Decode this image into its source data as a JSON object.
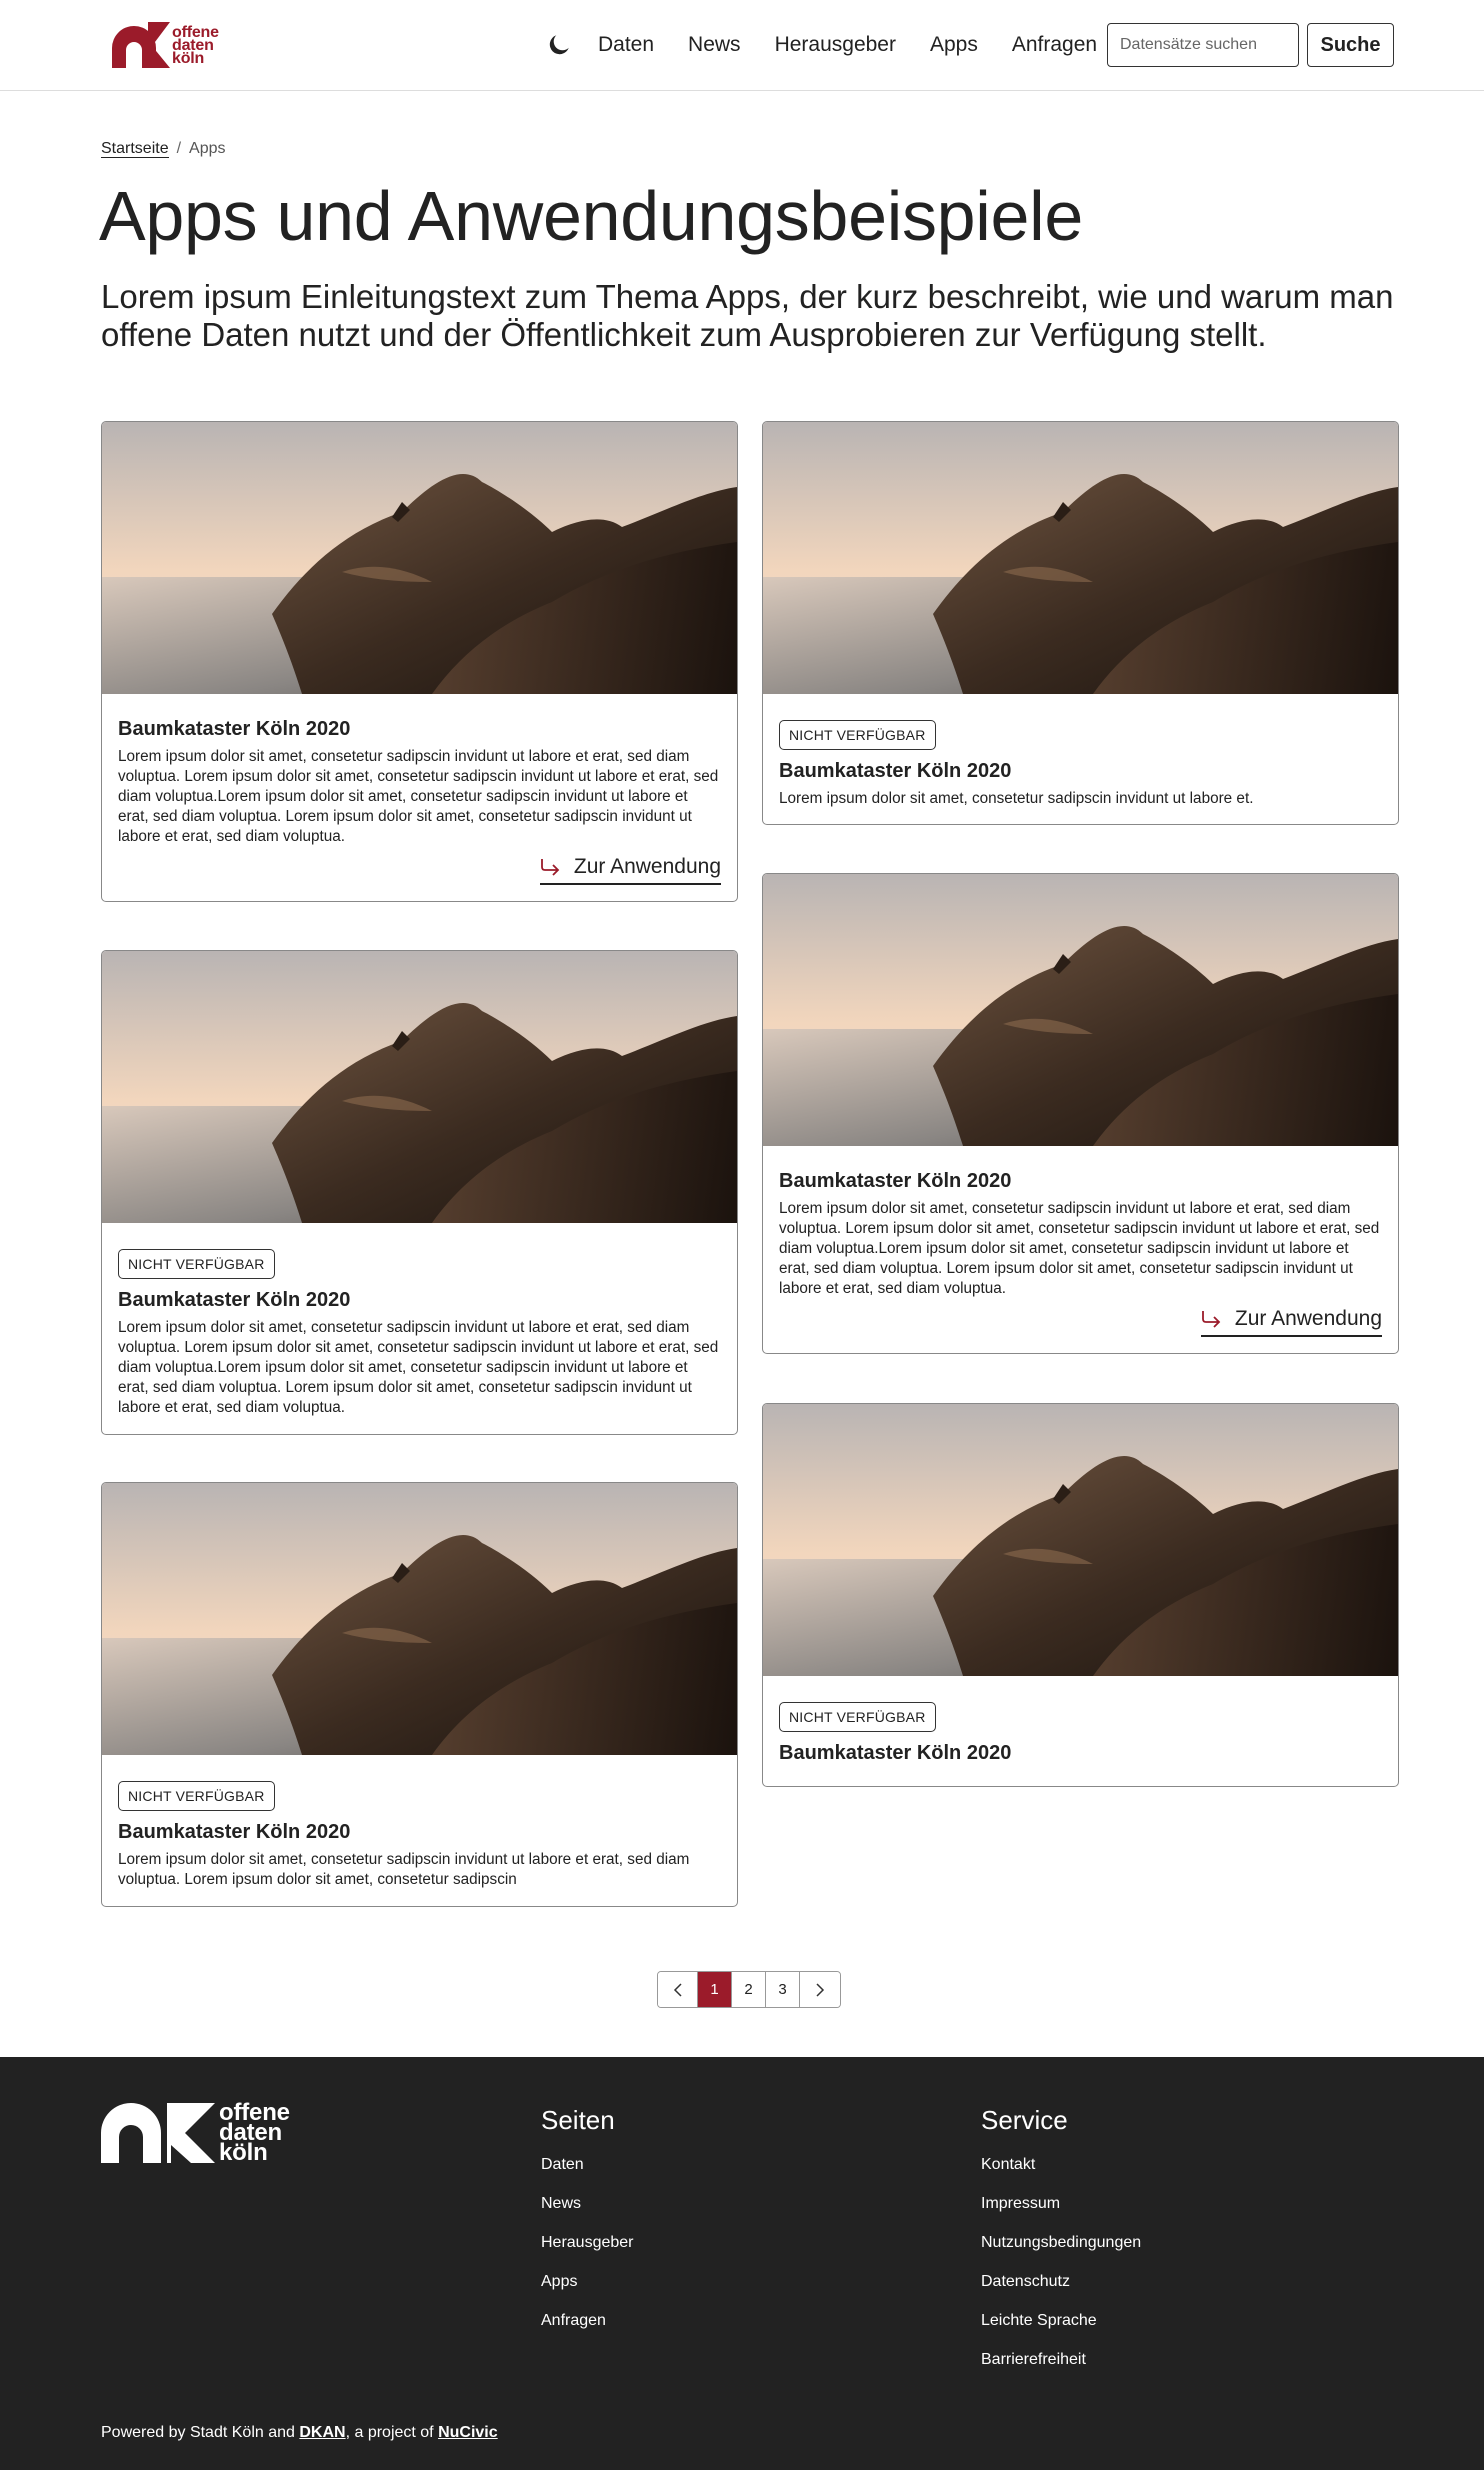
{
  "colors": {
    "brand": "#9b1b2a",
    "text": "#222222",
    "footer_bg": "#222222"
  },
  "logo": {
    "line1": "offene",
    "line2": "daten",
    "line3": "köln"
  },
  "header": {
    "theme_toggle_icon": "moon-icon",
    "nav": [
      "Daten",
      "News",
      "Herausgeber",
      "Apps",
      "Anfragen"
    ],
    "search_placeholder": "Datensätze suchen",
    "search_button": "Suche"
  },
  "breadcrumb": {
    "home": "Startseite",
    "separator": "/",
    "current": "Apps"
  },
  "page": {
    "title": "Apps und Anwendungsbeispiele",
    "intro": "Lorem ipsum Einleitungstext zum Thema Apps, der kurz beschreibt, wie und warum man offene Daten nutzt und der Öffentlichkeit zum Ausprobieren zur Verfügung stellt."
  },
  "cards": [
    {
      "title": "Baumkataster Köln 2020",
      "text": "Lorem ipsum dolor sit amet, consetetur sadipscin invidunt ut labore et erat, sed diam voluptua. Lorem ipsum dolor sit amet, consetetur sadipscin invidunt ut labore et erat, sed diam voluptua.Lorem ipsum dolor sit amet, consetetur sadipscin invidunt ut labore et erat, sed diam voluptua. Lorem ipsum dolor sit amet, consetetur sadipscin invidunt ut labore et erat, sed diam voluptua.",
      "cta": "Zur Anwendung"
    },
    {
      "badge": "NICHT VERFÜGBAR",
      "title": "Baumkataster Köln 2020",
      "text": "Lorem ipsum dolor sit amet, consetetur sadipscin invidunt ut labore et."
    },
    {
      "badge": "NICHT VERFÜGBAR",
      "title": "Baumkataster Köln 2020",
      "text": "Lorem ipsum dolor sit amet, consetetur sadipscin invidunt ut labore et erat, sed diam voluptua. Lorem ipsum dolor sit amet, consetetur sadipscin invidunt ut labore et erat, sed diam voluptua.Lorem ipsum dolor sit amet, consetetur sadipscin invidunt ut labore et erat, sed diam voluptua. Lorem ipsum dolor sit amet, consetetur sadipscin invidunt ut labore et erat, sed diam voluptua."
    },
    {
      "title": "Baumkataster Köln 2020",
      "text": "Lorem ipsum dolor sit amet, consetetur sadipscin invidunt ut labore et erat, sed diam voluptua. Lorem ipsum dolor sit amet, consetetur sadipscin invidunt ut labore et erat, sed diam voluptua.Lorem ipsum dolor sit amet, consetetur sadipscin invidunt ut labore et erat, sed diam voluptua. Lorem ipsum dolor sit amet, consetetur sadipscin invidunt ut labore et erat, sed diam voluptua.",
      "cta": "Zur Anwendung"
    },
    {
      "badge": "NICHT VERFÜGBAR",
      "title": "Baumkataster Köln 2020",
      "text": "Lorem ipsum dolor sit amet, consetetur sadipscin invidunt ut labore et erat, sed diam voluptua. Lorem ipsum dolor sit amet, consetetur sadipscin"
    },
    {
      "badge": "NICHT VERFÜGBAR",
      "title": "Baumkataster Köln 2020"
    }
  ],
  "pagination": {
    "pages": [
      "1",
      "2",
      "3"
    ],
    "current": "1"
  },
  "footer": {
    "pages_heading": "Seiten",
    "pages": [
      "Daten",
      "News",
      "Herausgeber",
      "Apps",
      "Anfragen"
    ],
    "service_heading": "Service",
    "service": [
      "Kontakt",
      "Impressum",
      "Nutzungsbedingungen",
      "Datenschutz",
      "Leichte Sprache",
      "Barrierefreiheit"
    ],
    "powered_prefix": "Powered by Stadt Köln and ",
    "powered_link1": "DKAN",
    "powered_middle": ", a project of ",
    "powered_link2": "NuCivic"
  }
}
